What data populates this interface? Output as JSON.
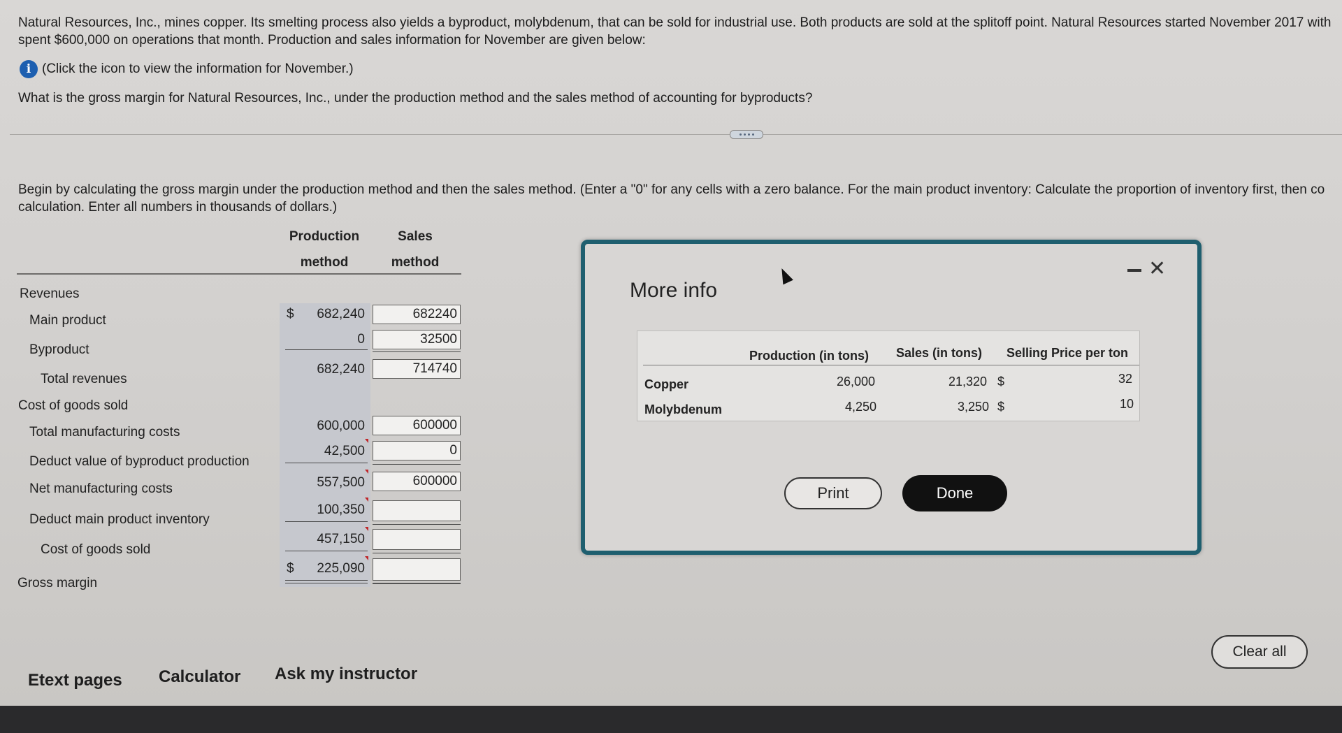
{
  "problem": {
    "line1": "Natural Resources, Inc., mines copper. Its smelting process also yields a byproduct, molybdenum, that can be sold for industrial use. Both products are sold at the splitoff point. Natural Resources started November 2017 with",
    "line2": "spent $600,000 on operations that month. Production and sales information for November are given below:",
    "info_hint": "(Click the icon to view the information for November.)",
    "question": "What is the gross margin for Natural Resources, Inc., under the production method and the sales method of accounting for byproducts?"
  },
  "instructions": {
    "line1": "Begin by calculating the gross margin under the production method and then the sales method. (Enter a \"0\" for any cells with a zero balance. For the main product inventory: Calculate the proportion of inventory first, then co",
    "line2": "calculation. Enter all numbers in thousands of dollars.)"
  },
  "table": {
    "col1_h1": "Production",
    "col1_h2": "method",
    "col2_h1": "Sales",
    "col2_h2": "method",
    "currency": "$",
    "rows": {
      "revenues": "Revenues",
      "main_product": "Main product",
      "byproduct": "Byproduct",
      "total_revenues": "Total revenues",
      "cogs_header": "Cost of goods sold",
      "total_mfg": "Total manufacturing costs",
      "deduct_byproduct": "Deduct value of byproduct production",
      "net_mfg": "Net manufacturing costs",
      "deduct_inventory": "Deduct main product inventory",
      "cogs": "Cost of goods sold",
      "gross_margin": "Gross margin"
    },
    "production": {
      "main_product": "682,240",
      "byproduct": "0",
      "total_revenues": "682,240",
      "total_mfg": "600,000",
      "deduct_byproduct": "42,500",
      "net_mfg": "557,500",
      "deduct_inventory": "100,350",
      "cogs": "457,150",
      "gross_margin": "225,090"
    },
    "sales": {
      "main_product": "682240",
      "byproduct": "32500",
      "total_revenues": "714740",
      "total_mfg": "600000",
      "deduct_byproduct": "0",
      "net_mfg": "600000",
      "deduct_inventory": "",
      "cogs": "",
      "gross_margin": ""
    }
  },
  "modal": {
    "title": "More info",
    "headers": [
      "Production (in tons)",
      "Sales (in tons)",
      "Selling Price per ton"
    ],
    "rows": [
      {
        "name": "Copper",
        "production": "26,000",
        "sales": "21,320",
        "currency": "$",
        "price": "32"
      },
      {
        "name": "Molybdenum",
        "production": "4,250",
        "sales": "3,250",
        "currency": "$",
        "price": "10"
      }
    ],
    "print_label": "Print",
    "done_label": "Done"
  },
  "footer": {
    "etext": "Etext pages",
    "calculator": "Calculator",
    "ask": "Ask my instructor",
    "clear_all": "Clear all"
  }
}
